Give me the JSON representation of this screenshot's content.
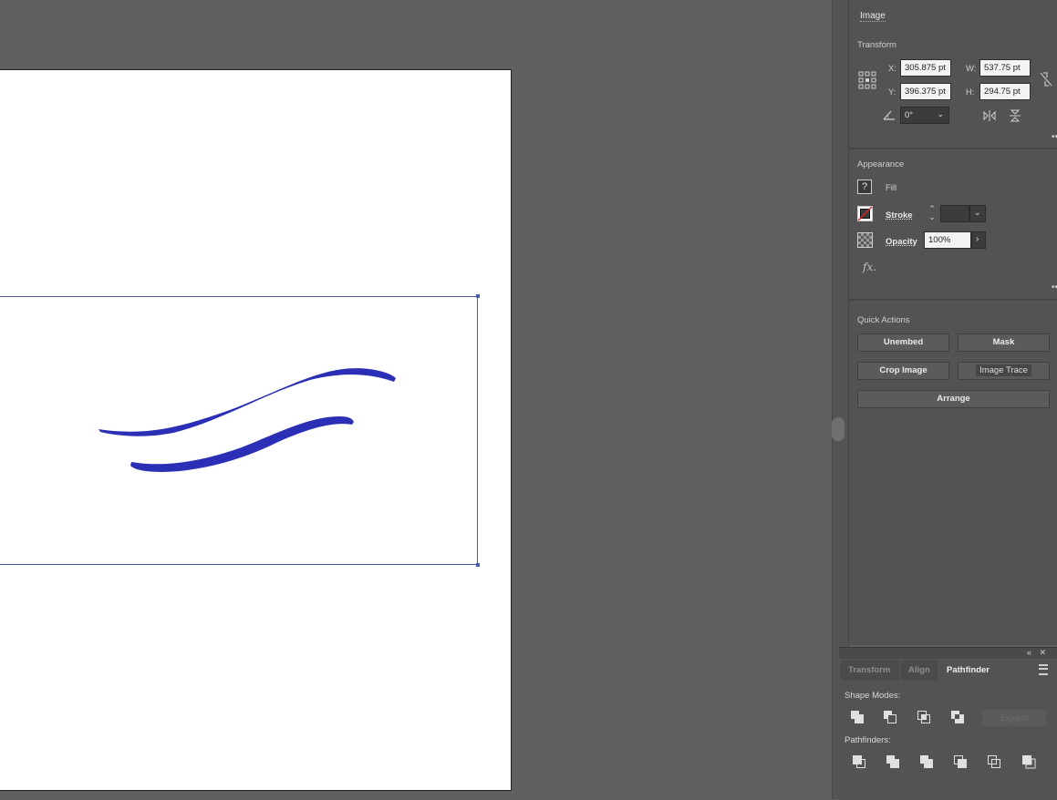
{
  "properties": {
    "object_type": "Image",
    "transform": {
      "title": "Transform",
      "x_label": "X:",
      "x_value": "305.875 pt",
      "y_label": "Y:",
      "y_value": "396.375 pt",
      "w_label": "W:",
      "w_value": "537.75 pt",
      "h_label": "H:",
      "h_value": "294.75 pt",
      "rotate_value": "0°"
    },
    "appearance": {
      "title": "Appearance",
      "fill_label": "Fill",
      "stroke_label": "Stroke",
      "opacity_label": "Opacity",
      "opacity_value": "100%",
      "fx_label": "fx."
    },
    "quick_actions": {
      "title": "Quick Actions",
      "unembed": "Unembed",
      "mask": "Mask",
      "crop_image": "Crop Image",
      "image_trace": "Image Trace",
      "arrange": "Arrange"
    }
  },
  "pathfinder_panel": {
    "tabs": [
      "Transform",
      "Align",
      "Pathfinder"
    ],
    "active_tab": "Pathfinder",
    "shape_modes_label": "Shape Modes:",
    "expand_label": "Expand",
    "pathfinders_label": "Pathfinders:"
  },
  "colors": {
    "stroke_blue": "#2a2fb6",
    "selection": "#4a5da0"
  }
}
